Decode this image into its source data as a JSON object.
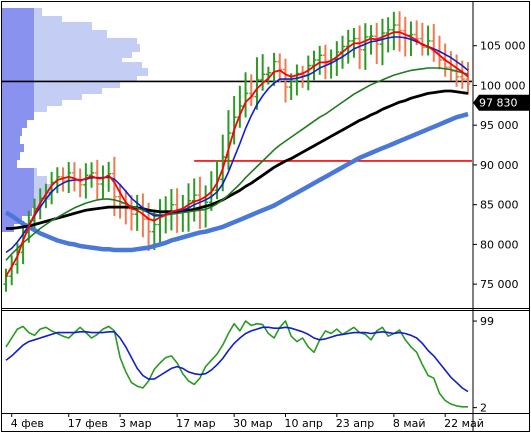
{
  "chart_data": [
    {
      "type": "ohlc-line",
      "y_ticks": [
        "105 000",
        "100 000",
        "95 000",
        "90 000",
        "85 000",
        "80 000",
        "75 000"
      ],
      "y_tick_values": [
        105000,
        100000,
        95000,
        90000,
        85000,
        80000,
        75000
      ],
      "ylim": [
        72000,
        110500
      ],
      "x_labels": [
        "4 фев",
        "17 фев",
        "3 мар",
        "17 мар",
        "30 мар",
        "10 апр",
        "23 апр",
        "8 май",
        "22 май"
      ],
      "x_label_index": [
        1,
        11,
        20,
        30,
        40,
        49,
        58,
        68,
        77
      ],
      "n_bars": 82,
      "current_price": 97830,
      "current_price_label": "97 830",
      "horizontal_levels": [
        {
          "value": 100500,
          "color": "#000000"
        },
        {
          "value": 90500,
          "color": "#ff0000",
          "from_index": 33
        }
      ],
      "colors": {
        "bull": "#2a9a20",
        "bear": "#f07a50",
        "ma_red": "#ff0000",
        "ma_blue": "#1020c8",
        "ma_green": "#207a20",
        "ma_black": "#000000",
        "ma_thick_blue": "#4a78d8",
        "price_tag_bg": "#000000",
        "volume_profile_dark": "#8a92f0",
        "volume_profile_light": "#c4cdf4"
      },
      "closes": [
        76000,
        77500,
        79000,
        81500,
        83000,
        84500,
        85800,
        86500,
        87800,
        88500,
        88000,
        89000,
        88200,
        87500,
        88700,
        89000,
        87600,
        88400,
        88900,
        86000,
        85200,
        84500,
        83800,
        84500,
        83200,
        81600,
        82500,
        83700,
        84200,
        85000,
        84000,
        84300,
        85500,
        86200,
        84800,
        85300,
        86800,
        88200,
        91000,
        94000,
        96000,
        97400,
        99000,
        98600,
        100700,
        101400,
        101600,
        103000,
        102000,
        99800,
        100500,
        101500,
        101300,
        102500,
        103200,
        103800,
        102800,
        103300,
        104200,
        104900,
        105600,
        105900,
        104500,
        106100,
        106200,
        105200,
        106600,
        107000,
        107600,
        106900,
        106300,
        106400,
        105900,
        104800,
        105600,
        104200,
        103200,
        102300,
        101800,
        101100,
        100800,
        100200
      ],
      "bar_direction": [
        "bull",
        "bull",
        "bull",
        "bull",
        "bull",
        "bull",
        "bull",
        "bull",
        "bull",
        "bull",
        "bear",
        "bull",
        "bear",
        "bear",
        "bull",
        "bull",
        "bear",
        "bull",
        "bull",
        "bear",
        "bear",
        "bear",
        "bear",
        "bull",
        "bear",
        "bear",
        "bull",
        "bull",
        "bull",
        "bull",
        "bear",
        "bull",
        "bull",
        "bull",
        "bear",
        "bull",
        "bull",
        "bull",
        "bull",
        "bull",
        "bull",
        "bull",
        "bull",
        "bear",
        "bull",
        "bull",
        "bull",
        "bull",
        "bear",
        "bear",
        "bull",
        "bull",
        "bear",
        "bull",
        "bull",
        "bull",
        "bear",
        "bull",
        "bull",
        "bull",
        "bull",
        "bull",
        "bear",
        "bull",
        "bull",
        "bear",
        "bull",
        "bull",
        "bull",
        "bear",
        "bear",
        "bull",
        "bear",
        "bear",
        "bull",
        "bear",
        "bear",
        "bear",
        "bear",
        "bear",
        "bear",
        "bear"
      ],
      "series": [
        {
          "key": "ma_red",
          "values": [
            76000,
            77200,
            78500,
            80500,
            82200,
            83800,
            85200,
            86300,
            87400,
            88100,
            88300,
            88500,
            88300,
            88000,
            88300,
            88600,
            88300,
            88300,
            88700,
            87800,
            86500,
            85300,
            84500,
            84300,
            83800,
            83200,
            83000,
            83400,
            83700,
            84100,
            84300,
            84500,
            85000,
            85400,
            85600,
            86000,
            86600,
            87700,
            89500,
            91900,
            94400,
            96300,
            97900,
            98600,
            99600,
            100300,
            100900,
            101700,
            101900,
            101400,
            101100,
            101300,
            101500,
            101900,
            102400,
            102900,
            102900,
            103100,
            103600,
            104200,
            104800,
            105300,
            105300,
            105600,
            105900,
            105800,
            106100,
            106400,
            106700,
            106700,
            106400,
            106100,
            105700,
            105100,
            104900,
            104400,
            103800,
            103200,
            102700,
            102200,
            101700,
            101100
          ]
        },
        {
          "key": "ma_blue",
          "values": [
            79000,
            79500,
            80300,
            81300,
            82400,
            83600,
            84700,
            85700,
            86600,
            87300,
            87700,
            88000,
            88100,
            88100,
            88200,
            88400,
            88400,
            88400,
            88500,
            88200,
            87500,
            86700,
            85800,
            85200,
            84600,
            84000,
            83600,
            83600,
            83700,
            84000,
            84200,
            84300,
            84600,
            85000,
            85300,
            85600,
            86000,
            86600,
            87600,
            89100,
            90900,
            92700,
            94600,
            96200,
            97600,
            98700,
            99600,
            100300,
            100800,
            100800,
            100800,
            100900,
            101100,
            101300,
            101700,
            102200,
            102500,
            102800,
            103200,
            103600,
            104100,
            104600,
            104900,
            105200,
            105500,
            105600,
            105800,
            106000,
            106100,
            106100,
            106000,
            105800,
            105500,
            105200,
            104900,
            104600,
            104300,
            103900,
            103500,
            103000,
            102500,
            101900
          ]
        },
        {
          "key": "ma_green",
          "values": [
            78000,
            78800,
            79500,
            80200,
            80800,
            81400,
            82000,
            82500,
            83000,
            83400,
            83800,
            84200,
            84600,
            84900,
            85200,
            85400,
            85600,
            85700,
            85700,
            85600,
            85400,
            85100,
            84800,
            84600,
            84300,
            84000,
            83800,
            83700,
            83700,
            83800,
            83900,
            84000,
            84100,
            84200,
            84300,
            84400,
            84700,
            85100,
            85600,
            86200,
            86900,
            87600,
            88400,
            89100,
            89800,
            90500,
            91200,
            91900,
            92500,
            93000,
            93500,
            94000,
            94500,
            95000,
            95500,
            96000,
            96400,
            96900,
            97400,
            97900,
            98400,
            98900,
            99300,
            99700,
            100100,
            100400,
            100700,
            101000,
            101300,
            101500,
            101700,
            101900,
            102000,
            102100,
            102200,
            102200,
            102200,
            102100,
            102000,
            101800,
            101600,
            101400
          ]
        },
        {
          "key": "ma_black",
          "values": [
            82000,
            82000,
            82100,
            82200,
            82300,
            82500,
            82700,
            82900,
            83100,
            83300,
            83500,
            83700,
            83900,
            84100,
            84300,
            84400,
            84500,
            84600,
            84700,
            84700,
            84700,
            84700,
            84700,
            84600,
            84500,
            84300,
            84200,
            84100,
            84100,
            84100,
            84100,
            84200,
            84300,
            84400,
            84600,
            84800,
            85000,
            85300,
            85600,
            86000,
            86400,
            86800,
            87300,
            87700,
            88200,
            88700,
            89200,
            89700,
            90100,
            90500,
            90800,
            91200,
            91600,
            92000,
            92400,
            92800,
            93200,
            93600,
            94000,
            94400,
            94800,
            95200,
            95600,
            95900,
            96300,
            96600,
            97000,
            97300,
            97600,
            97900,
            98100,
            98400,
            98600,
            98800,
            99000,
            99100,
            99200,
            99300,
            99300,
            99200,
            99100,
            99000
          ]
        },
        {
          "key": "ma_thick_blue",
          "values": [
            84000,
            83600,
            83100,
            82600,
            82200,
            81800,
            81400,
            81100,
            80800,
            80500,
            80300,
            80100,
            80000,
            79800,
            79700,
            79600,
            79500,
            79400,
            79400,
            79300,
            79300,
            79300,
            79300,
            79400,
            79500,
            79600,
            79800,
            80000,
            80200,
            80500,
            80700,
            80900,
            81100,
            81300,
            81500,
            81600,
            81800,
            82000,
            82200,
            82500,
            82800,
            83100,
            83400,
            83700,
            84000,
            84300,
            84600,
            84900,
            85300,
            85700,
            86100,
            86500,
            86900,
            87300,
            87700,
            88100,
            88500,
            88900,
            89300,
            89700,
            90100,
            90500,
            90900,
            91200,
            91500,
            91800,
            92100,
            92400,
            92700,
            93000,
            93300,
            93600,
            93900,
            94200,
            94500,
            94800,
            95100,
            95400,
            95700,
            96000,
            96200,
            96400
          ]
        }
      ]
    },
    {
      "type": "line",
      "y_ticks": [
        "99",
        "2"
      ],
      "ylim": [
        -4,
        108
      ],
      "series": [
        {
          "key": "osc_green",
          "values": [
            70,
            80,
            90,
            93,
            86,
            83,
            90,
            92,
            88,
            85,
            82,
            80,
            86,
            92,
            86,
            80,
            84,
            90,
            93,
            88,
            58,
            42,
            30,
            26,
            24,
            32,
            45,
            52,
            58,
            60,
            52,
            40,
            32,
            28,
            35,
            48,
            55,
            62,
            72,
            85,
            96,
            88,
            99,
            94,
            96,
            95,
            85,
            80,
            92,
            99,
            82,
            76,
            80,
            70,
            64,
            78,
            88,
            85,
            90,
            84,
            88,
            92,
            86,
            84,
            78,
            88,
            92,
            82,
            85,
            89,
            78,
            70,
            64,
            50,
            38,
            35,
            18,
            10,
            6,
            4,
            3,
            3
          ]
        },
        {
          "key": "osc_blue",
          "values": [
            55,
            60,
            66,
            72,
            76,
            78,
            80,
            82,
            84,
            86,
            86,
            86,
            86,
            87,
            87,
            86,
            86,
            86,
            87,
            87,
            80,
            70,
            58,
            46,
            38,
            34,
            34,
            38,
            42,
            46,
            48,
            46,
            42,
            40,
            39,
            40,
            44,
            50,
            57,
            66,
            74,
            80,
            85,
            88,
            90,
            92,
            92,
            91,
            91,
            92,
            91,
            89,
            87,
            84,
            80,
            78,
            79,
            81,
            83,
            84,
            85,
            86,
            86,
            86,
            85,
            86,
            87,
            86,
            85,
            86,
            85,
            83,
            80,
            74,
            66,
            60,
            52,
            44,
            36,
            30,
            24,
            20
          ]
        }
      ]
    }
  ]
}
